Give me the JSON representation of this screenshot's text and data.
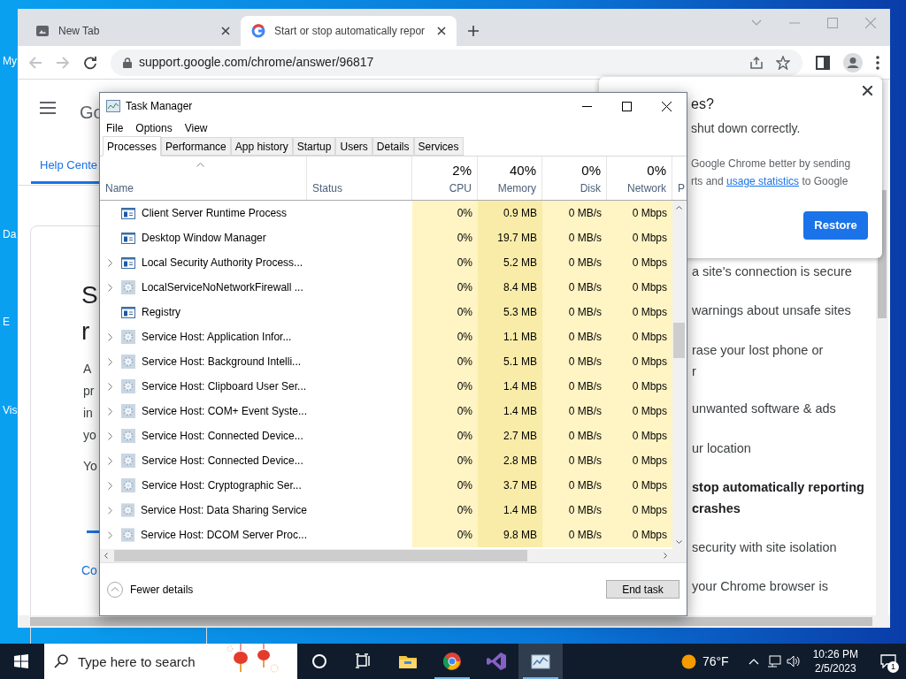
{
  "desktop_icons": [
    {
      "label": "My"
    },
    {
      "label": "Da"
    },
    {
      "label": "E"
    },
    {
      "label": "Vis"
    }
  ],
  "browser": {
    "tabs": [
      {
        "title": "New Tab",
        "selected": false
      },
      {
        "title": "Start or stop automatically repor",
        "selected": true
      }
    ],
    "url": "support.google.com/chrome/answer/96817",
    "page": {
      "logo": "Go",
      "help_center": "Help Cente",
      "heading_lines": [
        "S",
        "r"
      ],
      "paragraph_lines": [
        "A",
        "pr",
        "in",
        "yo"
      ],
      "second_paragraph": "Yo",
      "link": "Co",
      "article_list": [
        {
          "text": "a site's connection is secure",
          "selected": false
        },
        {
          "text": "warnings about unsafe sites",
          "selected": false
        },
        {
          "text": "rase your lost phone or\nr",
          "selected": false
        },
        {
          "text": "unwanted software & ads",
          "selected": false
        },
        {
          "text": "ur location",
          "selected": false
        },
        {
          "text": "stop automatically reporting\ncrashes",
          "selected": true
        },
        {
          "text": "security with site isolation",
          "selected": false
        },
        {
          "text": "your Chrome browser is",
          "selected": false
        }
      ]
    },
    "restore_popup": {
      "title": "es?",
      "message": "shut down correctly.",
      "consent_before": "Google Chrome better by sending\nrts and ",
      "consent_link": "usage statistics",
      "consent_after": " to Google",
      "button": "Restore"
    }
  },
  "task_manager": {
    "title": "Task Manager",
    "menu": [
      "File",
      "Options",
      "View"
    ],
    "tabs": [
      {
        "label": "Processes",
        "selected": true
      },
      {
        "label": "Performance",
        "selected": false
      },
      {
        "label": "App history",
        "selected": false
      },
      {
        "label": "Startup",
        "selected": false
      },
      {
        "label": "Users",
        "selected": false
      },
      {
        "label": "Details",
        "selected": false
      },
      {
        "label": "Services",
        "selected": false
      }
    ],
    "columns": [
      {
        "label": "Name"
      },
      {
        "label": "Status"
      },
      {
        "label": "CPU",
        "total": "2%"
      },
      {
        "label": "Memory",
        "total": "40%"
      },
      {
        "label": "Disk",
        "total": "0%"
      },
      {
        "label": "Network",
        "total": "0%"
      },
      {
        "label": "P"
      }
    ],
    "rows": [
      {
        "name": "Client Server Runtime Process",
        "kind": "app",
        "expandable": false,
        "cpu": "0%",
        "memory": "0.9 MB",
        "disk": "0 MB/s",
        "network": "0 Mbps"
      },
      {
        "name": "Desktop Window Manager",
        "kind": "app",
        "expandable": false,
        "cpu": "0%",
        "memory": "19.7 MB",
        "disk": "0 MB/s",
        "network": "0 Mbps"
      },
      {
        "name": "Local Security Authority Process...",
        "kind": "app",
        "expandable": true,
        "cpu": "0%",
        "memory": "5.2 MB",
        "disk": "0 MB/s",
        "network": "0 Mbps"
      },
      {
        "name": "LocalServiceNoNetworkFirewall ...",
        "kind": "service",
        "expandable": true,
        "cpu": "0%",
        "memory": "8.4 MB",
        "disk": "0 MB/s",
        "network": "0 Mbps"
      },
      {
        "name": "Registry",
        "kind": "app",
        "expandable": false,
        "cpu": "0%",
        "memory": "5.3 MB",
        "disk": "0 MB/s",
        "network": "0 Mbps"
      },
      {
        "name": "Service Host: Application Infor...",
        "kind": "service",
        "expandable": true,
        "cpu": "0%",
        "memory": "1.1 MB",
        "disk": "0 MB/s",
        "network": "0 Mbps"
      },
      {
        "name": "Service Host: Background Intelli...",
        "kind": "service",
        "expandable": true,
        "cpu": "0%",
        "memory": "5.1 MB",
        "disk": "0 MB/s",
        "network": "0 Mbps"
      },
      {
        "name": "Service Host: Clipboard User Ser...",
        "kind": "service",
        "expandable": true,
        "cpu": "0%",
        "memory": "1.4 MB",
        "disk": "0 MB/s",
        "network": "0 Mbps"
      },
      {
        "name": "Service Host: COM+ Event Syste...",
        "kind": "service",
        "expandable": true,
        "cpu": "0%",
        "memory": "1.4 MB",
        "disk": "0 MB/s",
        "network": "0 Mbps"
      },
      {
        "name": "Service Host: Connected Device...",
        "kind": "service",
        "expandable": true,
        "cpu": "0%",
        "memory": "2.7 MB",
        "disk": "0 MB/s",
        "network": "0 Mbps"
      },
      {
        "name": "Service Host: Connected Device...",
        "kind": "service",
        "expandable": true,
        "cpu": "0%",
        "memory": "2.8 MB",
        "disk": "0 MB/s",
        "network": "0 Mbps"
      },
      {
        "name": "Service Host: Cryptographic Ser...",
        "kind": "service",
        "expandable": true,
        "cpu": "0%",
        "memory": "3.7 MB",
        "disk": "0 MB/s",
        "network": "0 Mbps"
      },
      {
        "name": "Service Host: Data Sharing Service",
        "kind": "service",
        "expandable": true,
        "cpu": "0%",
        "memory": "1.4 MB",
        "disk": "0 MB/s",
        "network": "0 Mbps"
      },
      {
        "name": "Service Host: DCOM Server Proc...",
        "kind": "service",
        "expandable": true,
        "cpu": "0%",
        "memory": "9.8 MB",
        "disk": "0 MB/s",
        "network": "0 Mbps"
      }
    ],
    "fewer_details": "Fewer details",
    "end_task": "End task"
  },
  "taskbar": {
    "search_placeholder": "Type here to search",
    "apps": [
      {
        "kind": "cortana",
        "selected": false
      },
      {
        "kind": "taskview",
        "selected": false
      },
      {
        "kind": "explorer",
        "selected": false
      },
      {
        "kind": "chrome",
        "selected": false
      },
      {
        "kind": "studio",
        "selected": false
      },
      {
        "kind": "taskmanager",
        "selected": true
      }
    ],
    "temperature": "76°F",
    "time": "10:26 PM",
    "date": "2/5/2023",
    "notifications": "1"
  }
}
